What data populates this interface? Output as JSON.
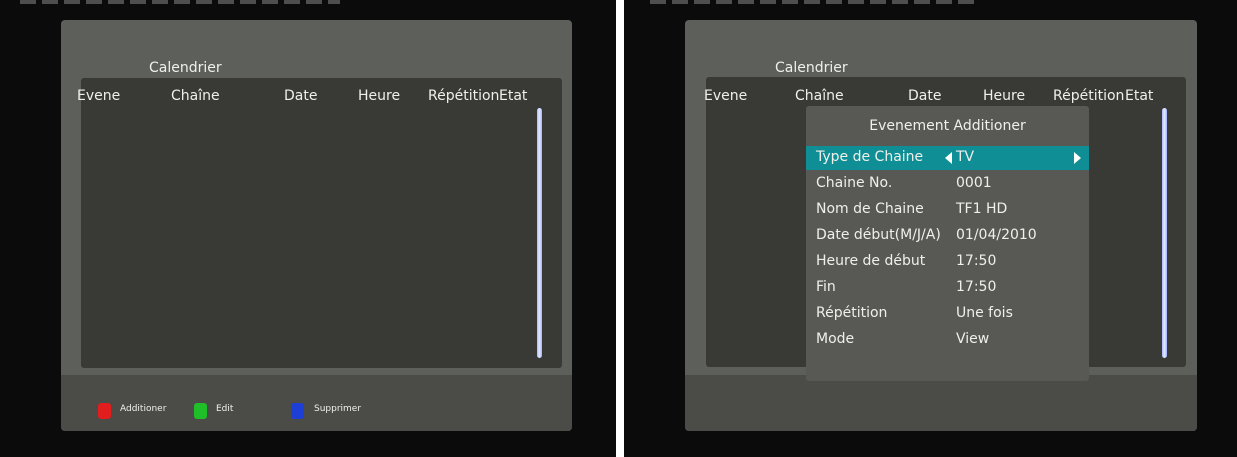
{
  "left_screen": {
    "title": "Calendrier",
    "columns": [
      "Evene",
      "Chaîne",
      "Date",
      "Heure",
      "Répétition",
      "Etat"
    ],
    "footer_keys": [
      {
        "label": "Additioner",
        "color": "#e11d1d"
      },
      {
        "label": "Edit",
        "color": "#1fbf2a"
      },
      {
        "label": "Supprimer",
        "color": "#1d3fd6"
      }
    ]
  },
  "right_screen": {
    "title": "Calendrier",
    "columns": [
      "Evene",
      "Chaîne",
      "Date",
      "Heure",
      "Répétition",
      "Etat"
    ],
    "dialog": {
      "title": "Evenement Additioner",
      "rows": [
        {
          "label": "Type de Chaine",
          "value": "TV",
          "selected": true
        },
        {
          "label": "Chaine No.",
          "value": "0001"
        },
        {
          "label": "Nom de Chaine",
          "value": "TF1 HD"
        },
        {
          "label": "Date début(M/J/A)",
          "value": "01/04/2010"
        },
        {
          "label": "Heure de début",
          "value": "17:50"
        },
        {
          "label": "Fin",
          "value": "17:50"
        },
        {
          "label": "Répétition",
          "value": "Une fois"
        },
        {
          "label": "Mode",
          "value": "View"
        }
      ]
    }
  },
  "colors": {
    "panel": "#5d5f5a",
    "list_area": "#393a36",
    "highlight": "#0f8f95",
    "scrollbar": "#cfd9ff"
  }
}
